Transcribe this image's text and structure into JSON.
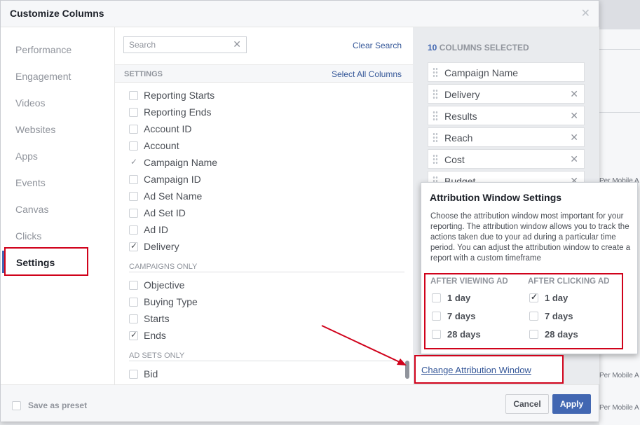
{
  "dialog": {
    "title": "Customize Columns"
  },
  "nav": {
    "items": [
      {
        "label": "Performance"
      },
      {
        "label": "Engagement"
      },
      {
        "label": "Videos"
      },
      {
        "label": "Websites"
      },
      {
        "label": "Apps"
      },
      {
        "label": "Events"
      },
      {
        "label": "Canvas"
      },
      {
        "label": "Clicks"
      },
      {
        "label": "Settings",
        "active": true
      }
    ]
  },
  "search": {
    "placeholder": "Search",
    "clear_label": "Clear Search"
  },
  "settings_section": {
    "label": "SETTINGS",
    "select_all": "Select All Columns"
  },
  "settings_items": [
    {
      "label": "Reporting Starts",
      "checked": false
    },
    {
      "label": "Reporting Ends",
      "checked": false
    },
    {
      "label": "Account ID",
      "checked": false
    },
    {
      "label": "Account",
      "checked": false
    },
    {
      "label": "Campaign Name",
      "checked": true,
      "locked": true
    },
    {
      "label": "Campaign ID",
      "checked": false
    },
    {
      "label": "Ad Set Name",
      "checked": false
    },
    {
      "label": "Ad Set ID",
      "checked": false
    },
    {
      "label": "Ad ID",
      "checked": false
    },
    {
      "label": "Delivery",
      "checked": true
    }
  ],
  "campaigns_only": {
    "label": "CAMPAIGNS ONLY",
    "items": [
      {
        "label": "Objective",
        "checked": false
      },
      {
        "label": "Buying Type",
        "checked": false
      },
      {
        "label": "Starts",
        "checked": false
      },
      {
        "label": "Ends",
        "checked": true
      }
    ]
  },
  "ad_sets_only": {
    "label": "AD SETS ONLY",
    "items": [
      {
        "label": "Bid",
        "checked": false
      }
    ]
  },
  "selected": {
    "count": "10",
    "count_suffix": "COLUMNS SELECTED",
    "columns": [
      {
        "label": "Campaign Name",
        "removable": false
      },
      {
        "label": "Delivery",
        "removable": true
      },
      {
        "label": "Results",
        "removable": true
      },
      {
        "label": "Reach",
        "removable": true
      },
      {
        "label": "Cost",
        "removable": true
      },
      {
        "label": "Budget",
        "removable": true
      }
    ]
  },
  "attribution": {
    "title": "Attribution Window Settings",
    "description": "Choose the attribution window most important for your reporting. The attribution window allows you to track the actions taken due to your ad during a particular time period. You can adjust the attribution window to create a report with a custom timeframe",
    "after_viewing": {
      "label": "AFTER VIEWING AD",
      "options": [
        {
          "label": "1 day",
          "checked": false
        },
        {
          "label": "7 days",
          "checked": false
        },
        {
          "label": "28 days",
          "checked": false
        }
      ]
    },
    "after_clicking": {
      "label": "AFTER CLICKING AD",
      "options": [
        {
          "label": "1 day",
          "checked": true
        },
        {
          "label": "7 days",
          "checked": false
        },
        {
          "label": "28 days",
          "checked": false
        }
      ]
    },
    "change_link": "Change Attribution Window"
  },
  "footer": {
    "preset_label": "Save as preset",
    "cancel": "Cancel",
    "apply": "Apply"
  },
  "background": {
    "row_text_1": "Per Mobile A",
    "row_text_2": "Per Mobile A",
    "row_text_3": "Per Mobile A"
  },
  "colors": {
    "accent": "#4267b2",
    "annotation": "#d0021b",
    "link": "#365899"
  }
}
